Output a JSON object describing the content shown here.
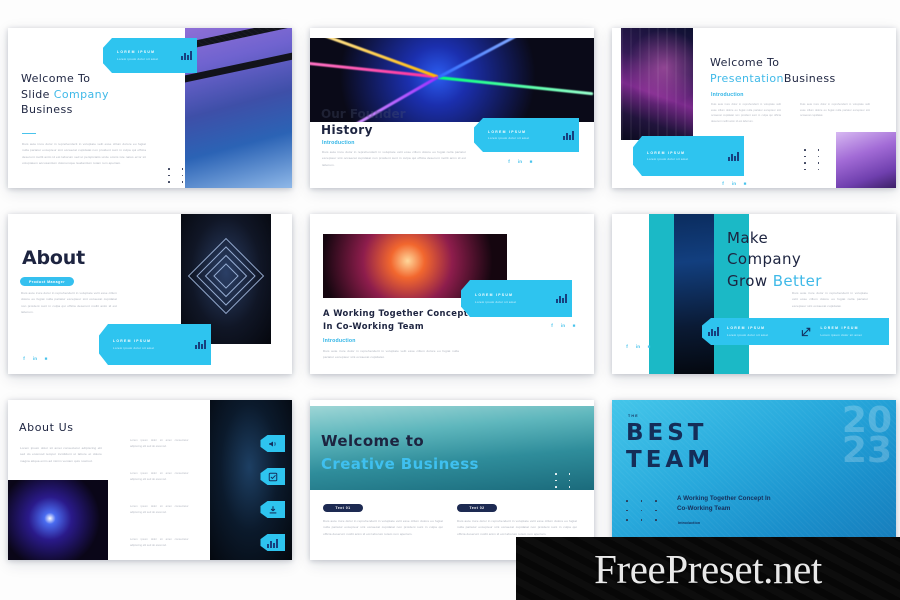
{
  "meta": {
    "kind": "presentation-template-preview",
    "accent_cyan": "#2EC4EF",
    "accent_light_blue": "#3FB9E8",
    "navy": "#1D2440",
    "body_gray": "#AEB3BD"
  },
  "watermark": {
    "text": "FreePreset.net"
  },
  "common": {
    "tag_title": "LOREM IPSUM",
    "tag_subtitle": "Lorem ipsum dolor sit amet",
    "introduction_label": "Introduction",
    "social": [
      {
        "name": "facebook",
        "glyph": "f"
      },
      {
        "name": "linkedin",
        "glyph": "in"
      },
      {
        "name": "instagram",
        "glyph": "■"
      }
    ],
    "lorem_long": "Duis aute irure dolor in reprehenderit in voluptate velit esse cillum dolore eu fugiat nulla pariatur excepteur sint occaecat cupidatat non proident sunt in culpa qui officia deserunt mollit anim id est laborum sed ut perspiciatis unde omnis iste natus error sit voluptatem accusantium doloremque laudantium totam rem aperiam.",
    "lorem_mid": "Duis aute irure dolor in reprehenderit in voluptate velit esse cillum dolore eu fugiat nulla pariatur excepteur sint occaecat cupidatat non proident sunt in culpa qui officia deserunt mollit anim id est laborum.",
    "lorem_short": "Duis aute irure dolor in reprehenderit in voluptate velit esse cillum dolore eu fugiat nulla pariatur excepteur sint occaecat cupidatat."
  },
  "slides": [
    {
      "id": "welcome-slide-company",
      "title_line1": "Welcome To",
      "title_line2_plain": "Slide ",
      "title_line2_accent": "Company",
      "title_line3": "Business"
    },
    {
      "id": "history",
      "ghost_title": "Our Founder",
      "title": "History",
      "label": "Introduction"
    },
    {
      "id": "welcome-presentation-business",
      "title_line1": "Welcome To",
      "title_line2_accent": "Presentation",
      "title_line2_plain": "Business",
      "label": "Introduction"
    },
    {
      "id": "about",
      "title": "About",
      "badge": "Product Manager"
    },
    {
      "id": "working-together-concept",
      "title_line1": "A Working Together Concept",
      "title_line2": "In Co-Working Team",
      "label": "Introduction"
    },
    {
      "id": "make-company-grow-better",
      "title_line1": "Make",
      "title_line2": "Company",
      "title_line3_plain": "Grow ",
      "title_line3_accent": "Better",
      "tags": [
        {
          "icon": "bar-chart-icon",
          "title": "LOREM IPSUM",
          "subtitle": "Lorem ipsum dolor sit amet"
        },
        {
          "icon": "external-link-icon",
          "title": "LOREM IPSUM",
          "subtitle": "Lorem ipsum dolor sit amet"
        }
      ]
    },
    {
      "id": "about-us",
      "title": "About Us",
      "intro": "Lorem ipsum dolor sit amet consectetur adipiscing elit sed do eiusmod tempor incididunt ut labore et dolore magna aliqua enim ad minim veniam quis nostrud.",
      "features": [
        {
          "icon": "megaphone-icon",
          "text": "Lorem ipsum dolor sit amet consectetur adipiscing elit sed do eiusmod."
        },
        {
          "icon": "check-box-icon",
          "text": "Lorem ipsum dolor sit amet consectetur adipiscing elit sed do eiusmod."
        },
        {
          "icon": "download-icon",
          "text": "Lorem ipsum dolor sit amet consectetur adipiscing elit sed do eiusmod."
        },
        {
          "icon": "bar-chart-icon",
          "text": "Lorem ipsum dolor sit amet consectetur adipiscing elit sed do eiusmod."
        }
      ]
    },
    {
      "id": "welcome-creative-business",
      "title_line1": "Welcome to",
      "title_line2": "Creative Business",
      "columns": [
        {
          "pill": "Text 01",
          "text": "Duis aute irure dolor in reprehenderit in voluptate velit esse cillum dolore eu fugiat nulla pariatur excepteur sint occaecat cupidatat non proident sunt in culpa qui officia deserunt mollit anim id est laborum totam rem aperiam."
        },
        {
          "pill": "Text 02",
          "text": "Duis aute irure dolor in reprehenderit in voluptate velit esse cillum dolore eu fugiat nulla pariatur excepteur sint occaecat cupidatat non proident sunt in culpa qui officia deserunt mollit anim id est laborum totam rem aperiam."
        }
      ]
    },
    {
      "id": "best-team",
      "eyebrow": "THE",
      "title_line1": "BEST",
      "title_line2": "TEAM",
      "subtitle_line1": "A Working Together Concept In",
      "subtitle_line2": "Co-Working Team",
      "label": "Introduction",
      "year_watermark": "2023"
    }
  ]
}
